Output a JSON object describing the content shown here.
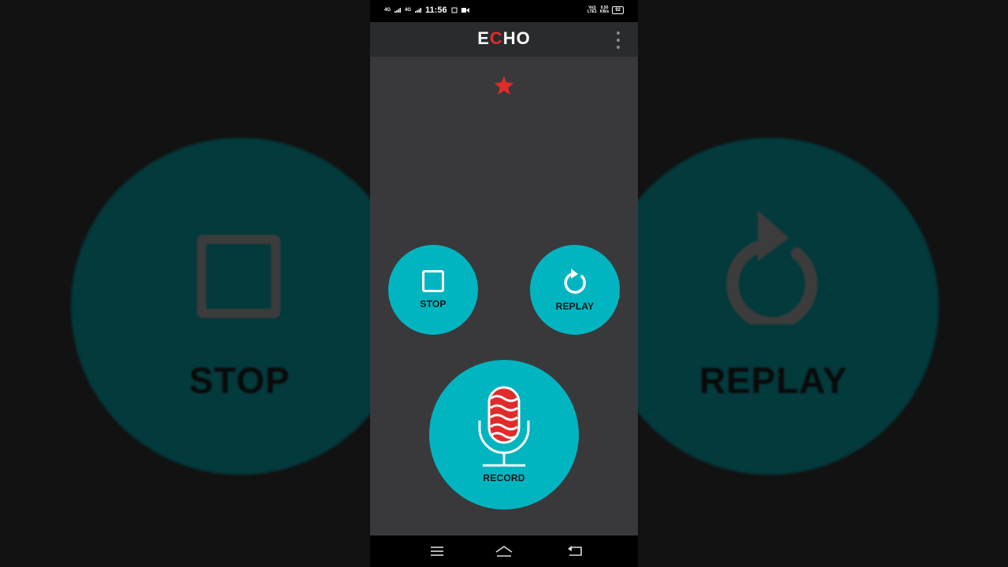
{
  "statusbar": {
    "time": "11:56",
    "network_1": "4G",
    "network_2": "4G",
    "volte": "Vo))",
    "lte": "LTE1",
    "speed_value": "0.50",
    "speed_unit": "KB/s",
    "battery": "92"
  },
  "appbar": {
    "logo_prefix": "E",
    "logo_dot": "C",
    "logo_suffix": "HO",
    "menu_icon": "more-vert-icon"
  },
  "controls": {
    "stop_label": "STOP",
    "replay_label": "REPLAY",
    "record_label": "RECORD"
  },
  "background_mirror": {
    "stop_label": "STOP",
    "replay_label": "REPLAY"
  },
  "navbar": {
    "items": [
      "menu-icon",
      "home-icon",
      "back-icon"
    ]
  },
  "colors": {
    "accent": "#00b5c0",
    "record_red": "#e12b2b",
    "app_background": "#39393b",
    "appbar": "#2a2b2d"
  }
}
